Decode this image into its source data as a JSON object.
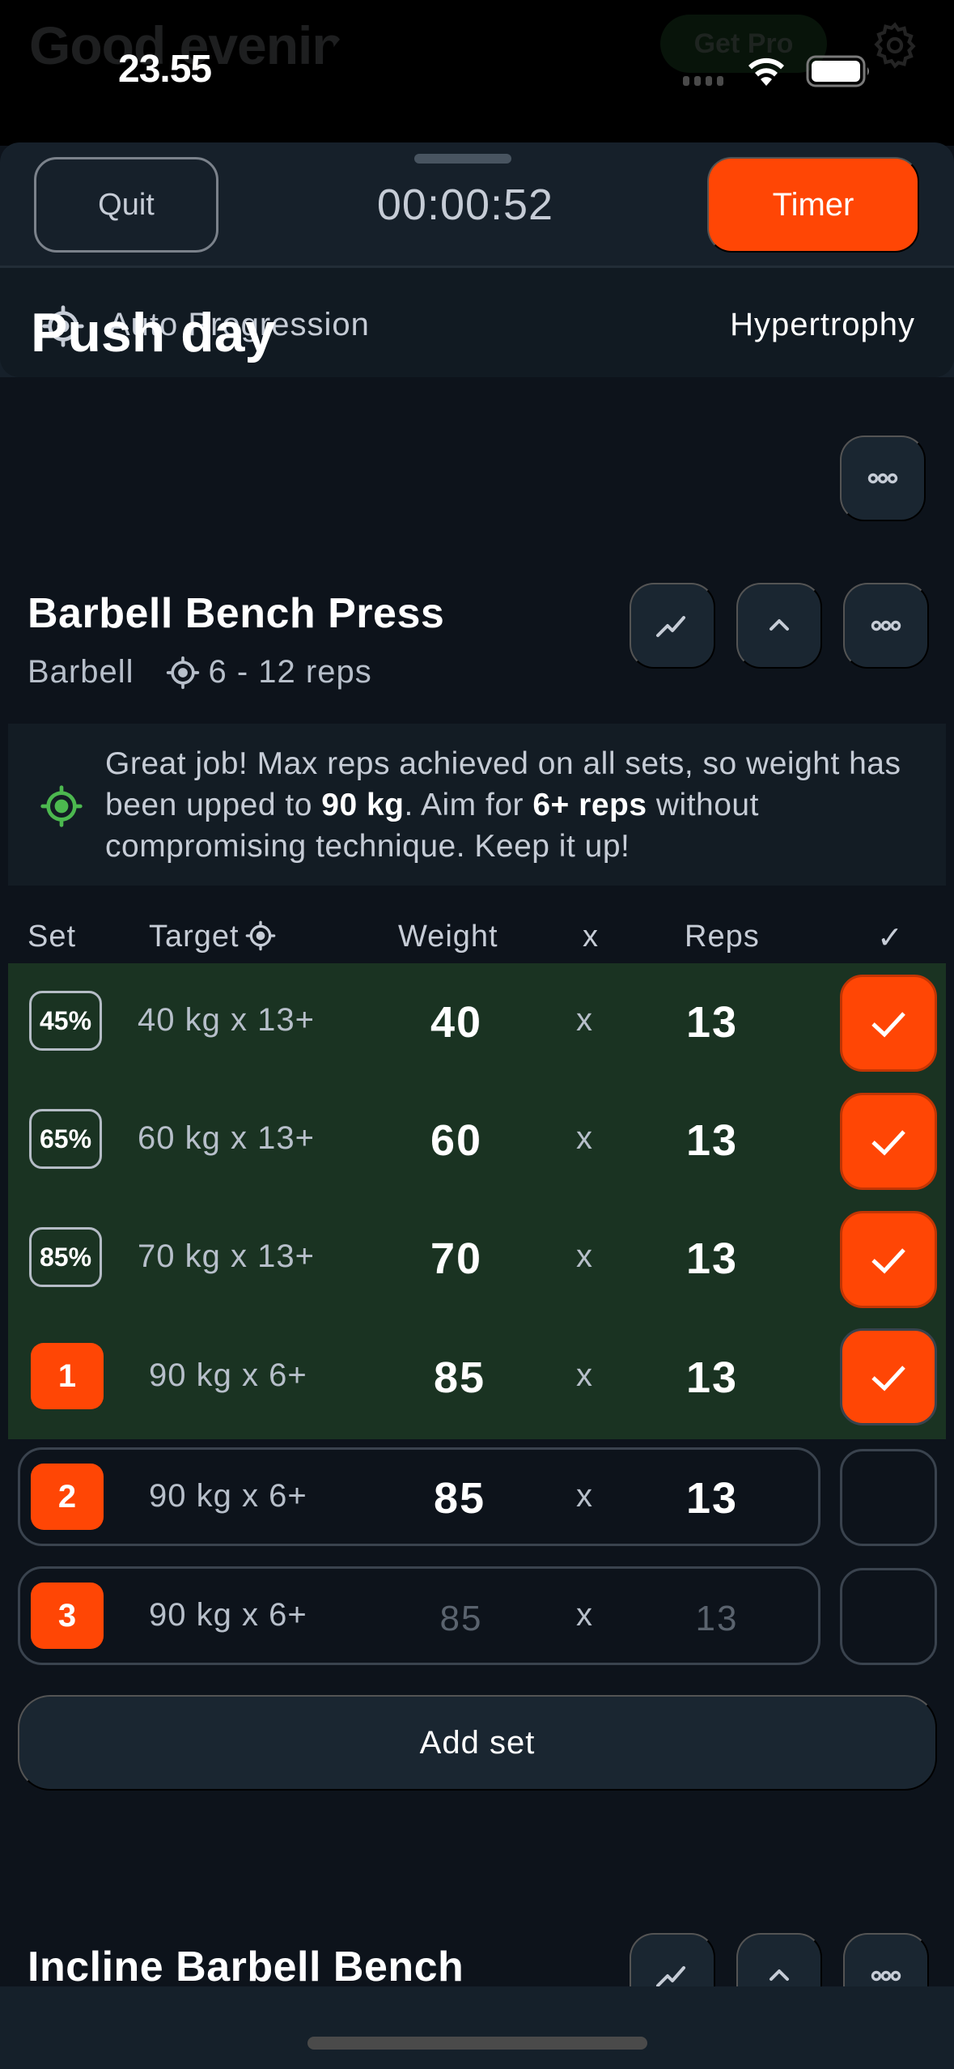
{
  "background": {
    "greeting": "Good evenin",
    "get_pro_label": "Get Pro"
  },
  "status_bar": {
    "time": "23.55"
  },
  "session": {
    "quit_label": "Quit",
    "elapsed": "00:00:52",
    "timer_label": "Timer",
    "auto_progression_label": "Auto Progression",
    "goal": "Hypertrophy"
  },
  "workout": {
    "title": "Push day"
  },
  "exercise": {
    "name": "Barbell Bench Press",
    "equipment": "Barbell",
    "rep_range": "6 - 12 reps",
    "notice": {
      "part1": "Great job! Max reps achieved on all sets, so weight has been upped to ",
      "weight": "90 kg",
      "part2": ". Aim for ",
      "reps": "6+ reps",
      "part3": " without compromising technique. Keep it up!"
    },
    "columns": {
      "set": "Set",
      "target": "Target",
      "weight": "Weight",
      "x": "x",
      "reps": "Reps",
      "done": "✓"
    },
    "sets": [
      {
        "label": "45%",
        "type": "warmup",
        "target": "40 kg x 13+",
        "weight": "40",
        "x": "x",
        "reps": "13",
        "done": true
      },
      {
        "label": "65%",
        "type": "warmup",
        "target": "60 kg x 13+",
        "weight": "60",
        "x": "x",
        "reps": "13",
        "done": true
      },
      {
        "label": "85%",
        "type": "warmup",
        "target": "70 kg x 13+",
        "weight": "70",
        "x": "x",
        "reps": "13",
        "done": true
      },
      {
        "label": "1",
        "type": "working",
        "target": "90 kg x 6+",
        "weight": "85",
        "x": "x",
        "reps": "13",
        "done": true
      },
      {
        "label": "2",
        "type": "working",
        "target": "90 kg x 6+",
        "weight": "85",
        "x": "x",
        "reps": "13",
        "done": false
      },
      {
        "label": "3",
        "type": "working",
        "target": "90 kg x 6+",
        "weight": "85",
        "x": "x",
        "reps": "13",
        "done": false,
        "placeholder": true
      }
    ],
    "add_set_label": "Add set"
  },
  "next_exercise": {
    "name": "Incline Barbell Bench"
  },
  "colors": {
    "accent": "#ff4605",
    "completed_row": "#1a3322",
    "success_icon": "#4cb84f",
    "background": "#0d131b",
    "surface": "#1a2631"
  }
}
